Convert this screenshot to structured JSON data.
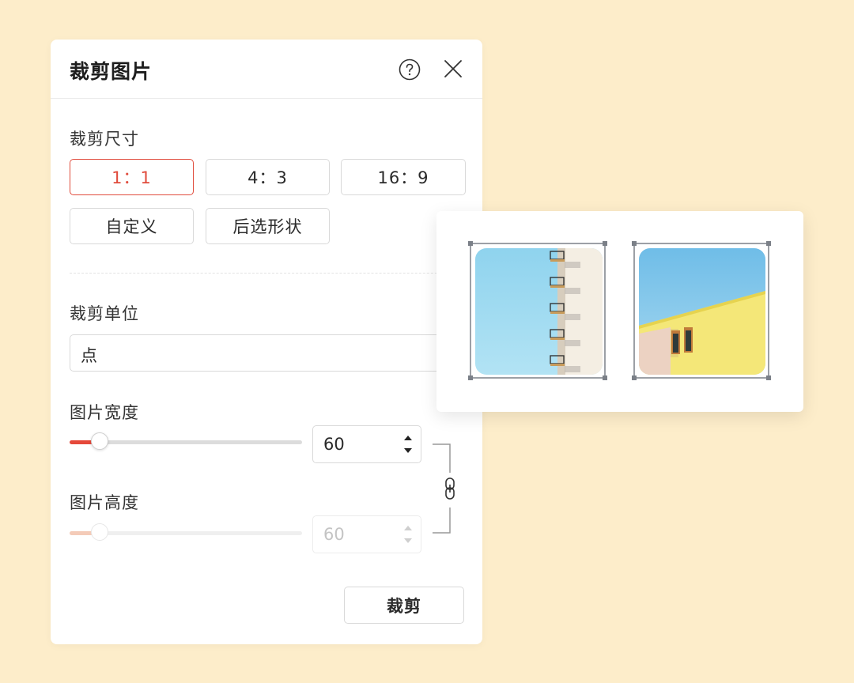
{
  "dialog": {
    "title": "裁剪图片",
    "help_icon": "question-circle-icon",
    "close_icon": "close-icon"
  },
  "crop_size": {
    "label": "裁剪尺寸",
    "options": [
      "1：1",
      "4：3",
      "16：9",
      "自定义",
      "后选形状"
    ],
    "selected": "1：1"
  },
  "crop_unit": {
    "label": "裁剪单位",
    "value": "点"
  },
  "image_width": {
    "label": "图片宽度",
    "value": "60",
    "slider_fraction": 0.13
  },
  "image_height": {
    "label": "图片高度",
    "value": "60",
    "slider_fraction": 0.13,
    "disabled": true
  },
  "link_icon": "link-chain-icon",
  "crop_button": "裁剪",
  "colors": {
    "background": "#fdedca",
    "accent": "#e04b3c",
    "slider_fill": "#e5483a"
  },
  "preview": {
    "images": [
      "building-balconies-image",
      "yellow-building-image"
    ]
  }
}
